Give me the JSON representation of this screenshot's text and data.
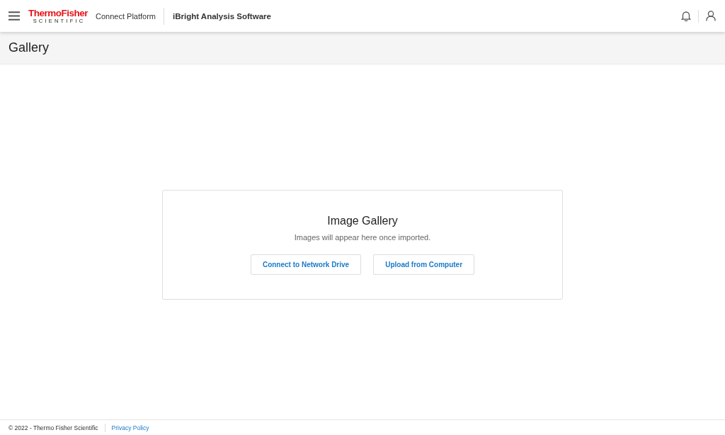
{
  "header": {
    "logo": {
      "wordmark": "ThermoFisher",
      "subtitle": "SCIENTIFIC"
    },
    "platform": "Connect Platform",
    "app_title": "iBright Analysis Software"
  },
  "page_title": "Gallery",
  "empty_state": {
    "title": "Image Gallery",
    "message": "Images will appear here once imported.",
    "buttons": [
      "Connect to Network Drive",
      "Upload from Computer"
    ]
  },
  "footer": {
    "copyright": "© 2022 - Thermo Fisher Scientific",
    "links": [
      "Privacy Policy"
    ]
  }
}
